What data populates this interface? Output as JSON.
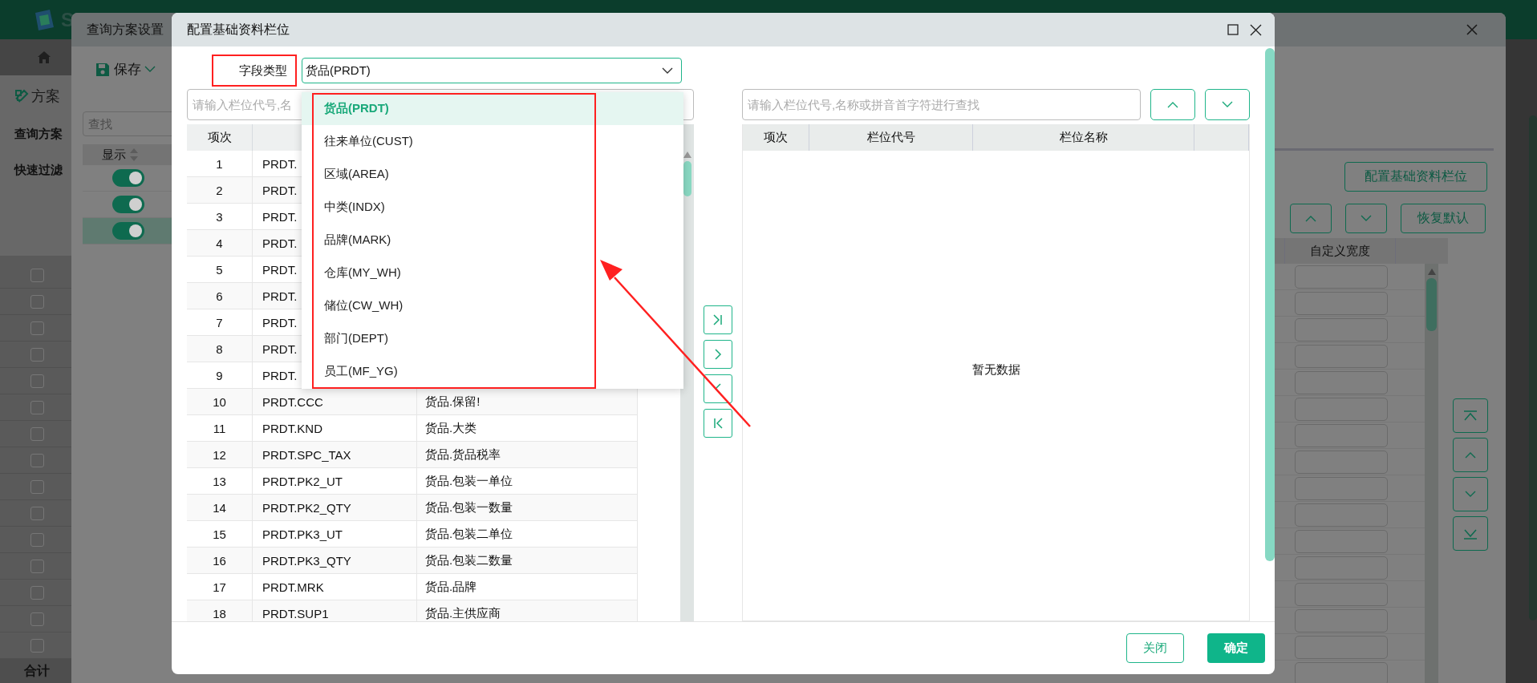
{
  "app": {
    "logo_text": "S",
    "plan_tab": "方案",
    "sections": [
      {
        "label": "查询方案"
      },
      {
        "label": "快速过滤"
      }
    ],
    "rows": [
      {
        "checked": false
      },
      {
        "checked": false
      },
      {
        "checked": false
      },
      {
        "checked": false
      },
      {
        "checked": false
      },
      {
        "checked": false
      },
      {
        "checked": false
      },
      {
        "checked": false
      },
      {
        "checked": false
      },
      {
        "checked": false
      },
      {
        "checked": false
      },
      {
        "checked": false
      },
      {
        "checked": false
      },
      {
        "checked": false
      },
      {
        "checked": false
      }
    ],
    "total_label": "合计"
  },
  "scheme_dialog": {
    "title": "查询方案设置",
    "save_label": "保存",
    "search": {
      "placeholder": "查找"
    },
    "show_column": "显示",
    "rows": [
      {
        "on": true,
        "selected": false
      },
      {
        "on": true,
        "selected": false
      },
      {
        "on": true,
        "selected": true
      }
    ],
    "config_button": "配置基础资料栏位",
    "restore_button": "恢复默认",
    "width_column": "自定义宽度"
  },
  "config_dialog": {
    "title": "配置基础资料栏位",
    "field_type": {
      "label": "字段类型",
      "label_highlighted": true,
      "value": "货品(PRDT)",
      "expanded": true,
      "options_highlighted": true,
      "options": [
        {
          "label": "货品(PRDT)",
          "selected": true
        },
        {
          "label": "往来单位(CUST)",
          "selected": false
        },
        {
          "label": "区域(AREA)",
          "selected": false
        },
        {
          "label": "中类(INDX)",
          "selected": false
        },
        {
          "label": "品牌(MARK)",
          "selected": false
        },
        {
          "label": "仓库(MY_WH)",
          "selected": false
        },
        {
          "label": "储位(CW_WH)",
          "selected": false
        },
        {
          "label": "部门(DEPT)",
          "selected": false
        },
        {
          "label": "员工(MF_YG)",
          "selected": false
        }
      ]
    },
    "left_search": {
      "placeholder": "请输入栏位代号,名"
    },
    "left_table": {
      "columns": [
        "项次"
      ],
      "rows": [
        {
          "no": "1",
          "code": "PRDT."
        },
        {
          "no": "2",
          "code": "PRDT."
        },
        {
          "no": "3",
          "code": "PRDT."
        },
        {
          "no": "4",
          "code": "PRDT."
        },
        {
          "no": "5",
          "code": "PRDT."
        },
        {
          "no": "6",
          "code": "PRDT."
        },
        {
          "no": "7",
          "code": "PRDT."
        },
        {
          "no": "8",
          "code": "PRDT."
        },
        {
          "no": "9",
          "code": "PRDT."
        },
        {
          "no": "10",
          "code": "PRDT.CCC",
          "name": "货品.保留!"
        },
        {
          "no": "11",
          "code": "PRDT.KND",
          "name": "货品.大类"
        },
        {
          "no": "12",
          "code": "PRDT.SPC_TAX",
          "name": "货品.货品税率"
        },
        {
          "no": "13",
          "code": "PRDT.PK2_UT",
          "name": "货品.包装一单位"
        },
        {
          "no": "14",
          "code": "PRDT.PK2_QTY",
          "name": "货品.包装一数量"
        },
        {
          "no": "15",
          "code": "PRDT.PK3_UT",
          "name": "货品.包装二单位"
        },
        {
          "no": "16",
          "code": "PRDT.PK3_QTY",
          "name": "货品.包装二数量"
        },
        {
          "no": "17",
          "code": "PRDT.MRK",
          "name": "货品.品牌"
        },
        {
          "no": "18",
          "code": "PRDT.SUP1",
          "name": "货品.主供应商"
        }
      ]
    },
    "right_search": {
      "placeholder": "请输入栏位代号,名称或拼音首字符进行查找"
    },
    "right_table": {
      "columns": [
        "项次",
        "栏位代号",
        "栏位名称"
      ],
      "empty_text": "暂无数据"
    },
    "buttons": [
      {
        "label": "关闭",
        "kind": "secondary"
      },
      {
        "label": "确定",
        "kind": "primary"
      }
    ]
  },
  "annotation_arrow": true
}
